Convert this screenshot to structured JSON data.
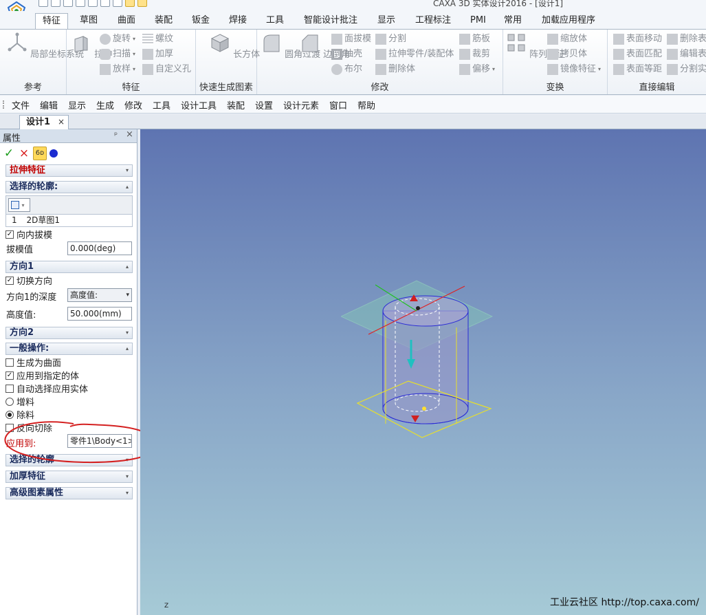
{
  "window": {
    "title": "CAXA 3D 实体设计2016 - [设计1]"
  },
  "ribbon_tabs": [
    "特征",
    "草图",
    "曲面",
    "装配",
    "钣金",
    "焊接",
    "工具",
    "智能设计批注",
    "显示",
    "工程标注",
    "PMI",
    "常用",
    "加载应用程序"
  ],
  "ribbon": {
    "groups": {
      "ref": "参考",
      "feature": "特征",
      "quick": "快速生成图素",
      "modify": "修改",
      "transform": "变换",
      "direct": "直接编辑"
    },
    "buttons": {
      "local_coord": "局部坐标系统",
      "extrude": "拉伸",
      "revolve": "旋转",
      "sweep": "扫描",
      "loft": "放样",
      "thread": "螺纹",
      "thicken": "加厚",
      "custom_hole": "自定义孔",
      "box": "长方体",
      "fillet": "圆角过渡",
      "chamfer": "边倒角",
      "draft": "面拔模",
      "shell": "抽壳",
      "boolean": "布尔",
      "split": "分割",
      "extrude_part": "拉伸零件/装配体",
      "delete_body": "删除体",
      "rib": "筋板",
      "trim": "裁剪",
      "offset": "偏移",
      "pattern": "阵列特征",
      "scale": "缩放体",
      "copy_body": "拷贝体",
      "mirror": "镜像特征",
      "face_move": "表面移动",
      "face_match": "表面匹配",
      "face_equidistant": "表面等距",
      "delete_face": "删除表",
      "edit_face": "编辑表",
      "split_solid": "分割实"
    }
  },
  "menu": [
    "文件",
    "编辑",
    "显示",
    "生成",
    "修改",
    "工具",
    "设计工具",
    "装配",
    "设置",
    "设计元素",
    "窗口",
    "帮助"
  ],
  "doc_tab": {
    "label": "设计1",
    "close": "×"
  },
  "panel": {
    "title": "属性",
    "pin": "ᵖ",
    "close": "×",
    "preview_glyph": "6ᴅ",
    "section_extrude": "拉伸特征",
    "section_profile": "选择的轮廓:",
    "sketch_item_index": "1",
    "sketch_item": "2D草图1",
    "inward_draft": "向内拔模",
    "draft_label": "拔模值",
    "draft_value": "0.000(deg)",
    "section_dir1": "方向1",
    "switch_dir": "切换方向",
    "depth_label": "方向1的深度",
    "depth_value": "高度值:",
    "height_label": "高度值:",
    "height_value": "50.000(mm)",
    "section_dir2": "方向2",
    "section_general": "一般操作:",
    "gen_surface": "生成为曲面",
    "apply_body": "应用到指定的体",
    "auto_select": "自动选择应用实体",
    "add_material": "增料",
    "remove_material": "除料",
    "reverse_cut": "反向切除",
    "apply_to_label": "应用到:",
    "apply_to_value": "零件1\\Body<1>",
    "section_profile2": "选择的轮廓",
    "section_thicken": "加厚特征",
    "section_advanced": "高级图素属性",
    "checkbox_mark": "✓",
    "arrow_down": "▾",
    "arrow_up": "▴"
  },
  "viewport": {
    "watermark": "工业云社区 http://top.caxa.com/",
    "axis_label": "Z"
  },
  "colors": {
    "viewport_top": "#5e74b1",
    "viewport_bottom": "#a6cad6",
    "section_red": "#c00000",
    "annotation_red": "#d42020"
  }
}
